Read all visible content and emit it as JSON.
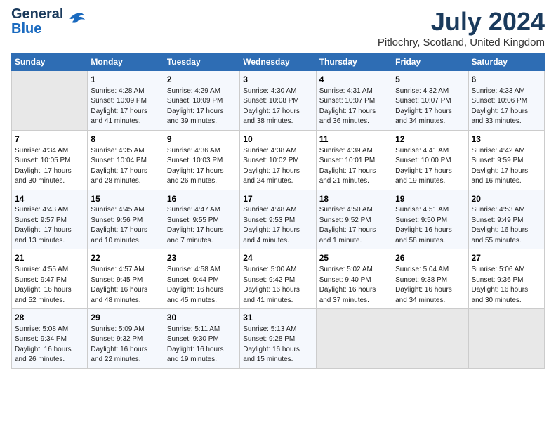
{
  "logo": {
    "line1": "General",
    "line2": "Blue"
  },
  "title": "July 2024",
  "subtitle": "Pitlochry, Scotland, United Kingdom",
  "days_header": [
    "Sunday",
    "Monday",
    "Tuesday",
    "Wednesday",
    "Thursday",
    "Friday",
    "Saturday"
  ],
  "weeks": [
    [
      {
        "day": "",
        "content": ""
      },
      {
        "day": "1",
        "content": "Sunrise: 4:28 AM\nSunset: 10:09 PM\nDaylight: 17 hours\nand 41 minutes."
      },
      {
        "day": "2",
        "content": "Sunrise: 4:29 AM\nSunset: 10:09 PM\nDaylight: 17 hours\nand 39 minutes."
      },
      {
        "day": "3",
        "content": "Sunrise: 4:30 AM\nSunset: 10:08 PM\nDaylight: 17 hours\nand 38 minutes."
      },
      {
        "day": "4",
        "content": "Sunrise: 4:31 AM\nSunset: 10:07 PM\nDaylight: 17 hours\nand 36 minutes."
      },
      {
        "day": "5",
        "content": "Sunrise: 4:32 AM\nSunset: 10:07 PM\nDaylight: 17 hours\nand 34 minutes."
      },
      {
        "day": "6",
        "content": "Sunrise: 4:33 AM\nSunset: 10:06 PM\nDaylight: 17 hours\nand 33 minutes."
      }
    ],
    [
      {
        "day": "7",
        "content": "Sunrise: 4:34 AM\nSunset: 10:05 PM\nDaylight: 17 hours\nand 30 minutes."
      },
      {
        "day": "8",
        "content": "Sunrise: 4:35 AM\nSunset: 10:04 PM\nDaylight: 17 hours\nand 28 minutes."
      },
      {
        "day": "9",
        "content": "Sunrise: 4:36 AM\nSunset: 10:03 PM\nDaylight: 17 hours\nand 26 minutes."
      },
      {
        "day": "10",
        "content": "Sunrise: 4:38 AM\nSunset: 10:02 PM\nDaylight: 17 hours\nand 24 minutes."
      },
      {
        "day": "11",
        "content": "Sunrise: 4:39 AM\nSunset: 10:01 PM\nDaylight: 17 hours\nand 21 minutes."
      },
      {
        "day": "12",
        "content": "Sunrise: 4:41 AM\nSunset: 10:00 PM\nDaylight: 17 hours\nand 19 minutes."
      },
      {
        "day": "13",
        "content": "Sunrise: 4:42 AM\nSunset: 9:59 PM\nDaylight: 17 hours\nand 16 minutes."
      }
    ],
    [
      {
        "day": "14",
        "content": "Sunrise: 4:43 AM\nSunset: 9:57 PM\nDaylight: 17 hours\nand 13 minutes."
      },
      {
        "day": "15",
        "content": "Sunrise: 4:45 AM\nSunset: 9:56 PM\nDaylight: 17 hours\nand 10 minutes."
      },
      {
        "day": "16",
        "content": "Sunrise: 4:47 AM\nSunset: 9:55 PM\nDaylight: 17 hours\nand 7 minutes."
      },
      {
        "day": "17",
        "content": "Sunrise: 4:48 AM\nSunset: 9:53 PM\nDaylight: 17 hours\nand 4 minutes."
      },
      {
        "day": "18",
        "content": "Sunrise: 4:50 AM\nSunset: 9:52 PM\nDaylight: 17 hours\nand 1 minute."
      },
      {
        "day": "19",
        "content": "Sunrise: 4:51 AM\nSunset: 9:50 PM\nDaylight: 16 hours\nand 58 minutes."
      },
      {
        "day": "20",
        "content": "Sunrise: 4:53 AM\nSunset: 9:49 PM\nDaylight: 16 hours\nand 55 minutes."
      }
    ],
    [
      {
        "day": "21",
        "content": "Sunrise: 4:55 AM\nSunset: 9:47 PM\nDaylight: 16 hours\nand 52 minutes."
      },
      {
        "day": "22",
        "content": "Sunrise: 4:57 AM\nSunset: 9:45 PM\nDaylight: 16 hours\nand 48 minutes."
      },
      {
        "day": "23",
        "content": "Sunrise: 4:58 AM\nSunset: 9:44 PM\nDaylight: 16 hours\nand 45 minutes."
      },
      {
        "day": "24",
        "content": "Sunrise: 5:00 AM\nSunset: 9:42 PM\nDaylight: 16 hours\nand 41 minutes."
      },
      {
        "day": "25",
        "content": "Sunrise: 5:02 AM\nSunset: 9:40 PM\nDaylight: 16 hours\nand 37 minutes."
      },
      {
        "day": "26",
        "content": "Sunrise: 5:04 AM\nSunset: 9:38 PM\nDaylight: 16 hours\nand 34 minutes."
      },
      {
        "day": "27",
        "content": "Sunrise: 5:06 AM\nSunset: 9:36 PM\nDaylight: 16 hours\nand 30 minutes."
      }
    ],
    [
      {
        "day": "28",
        "content": "Sunrise: 5:08 AM\nSunset: 9:34 PM\nDaylight: 16 hours\nand 26 minutes."
      },
      {
        "day": "29",
        "content": "Sunrise: 5:09 AM\nSunset: 9:32 PM\nDaylight: 16 hours\nand 22 minutes."
      },
      {
        "day": "30",
        "content": "Sunrise: 5:11 AM\nSunset: 9:30 PM\nDaylight: 16 hours\nand 19 minutes."
      },
      {
        "day": "31",
        "content": "Sunrise: 5:13 AM\nSunset: 9:28 PM\nDaylight: 16 hours\nand 15 minutes."
      },
      {
        "day": "",
        "content": ""
      },
      {
        "day": "",
        "content": ""
      },
      {
        "day": "",
        "content": ""
      }
    ]
  ]
}
